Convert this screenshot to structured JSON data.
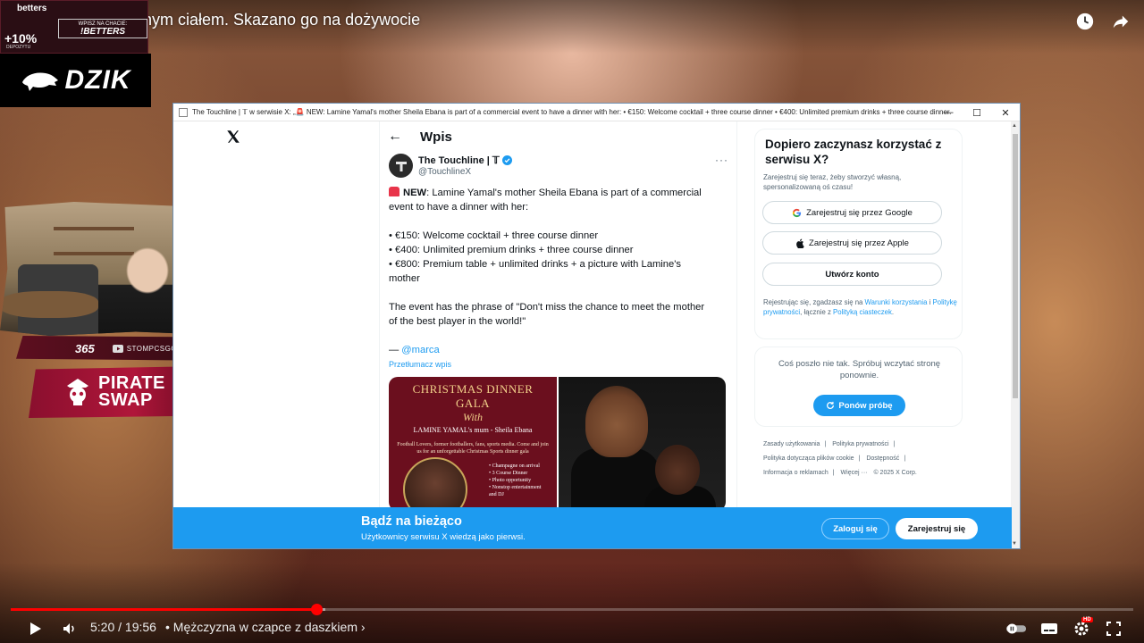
{
  "video": {
    "title": "nym ciałem. Skazano go na dożywocie",
    "current_time": "5:20",
    "duration": "19:56",
    "time_separator": "/",
    "chapter": "Mężczyzna w czapce z daszkiem",
    "progress_fraction": 0.272,
    "buffered_fraction": 0.28
  },
  "overlays": {
    "betters": {
      "logo": "betters",
      "percent": "+10%",
      "percent_sub": "DEPOZYTU",
      "chat_label": "WPISZ NA CHACIE:",
      "chat_code": "!BETTERS"
    },
    "dzik": "DZIK",
    "s365": "365",
    "youtube_handle": "STOMPCSGO",
    "pirate_line1": "PIRATE",
    "pirate_line2": "SWAP"
  },
  "browser": {
    "window_title": "The Touchline | 𝕋 w serwisie X: „🚨 NEW: Lamine Yamal's mother Sheila Ebana is part of a commercial event to have a dinner with her: • €150: Welcome cocktail + three course dinner • €400: Unlimited premium drinks + three course dinner..."
  },
  "x": {
    "header_title": "Wpis",
    "author_name": "The Touchline | 𝕋",
    "author_handle": "@TouchlineX",
    "more": "···",
    "tweet": {
      "new_label": "NEW",
      "line1_rest": ": Lamine Yamal's mother Sheila Ebana is part of a commercial",
      "line2": "event to have a dinner with her:",
      "bullet1": "• €150: Welcome cocktail + three course dinner",
      "bullet2": "• €400: Unlimited premium drinks + three course dinner",
      "bullet3a": "• €800: Premium table + unlimited drinks + a picture with Lamine's",
      "bullet3b": "mother",
      "quote_a": "The event has the phrase of \"Don't miss the chance to meet the mother",
      "quote_b": "of the best player in the world!\"",
      "dash": "— ",
      "source_link": "@marca",
      "translate": "Przetłumacz wpis"
    },
    "poster": {
      "title1": "CHRISTMAS DINNER GALA",
      "title2": "With",
      "subtitle": "LAMINE YAMAL's mum - Sheila Ebana",
      "desc": "Football Lovers, former footballers, fans, sports media. Come and join us for an unforgettable Christmas Sports dinner gala",
      "bullets": [
        "• Champagne on arrival",
        "• 3 Course Dinner",
        "• Photo opportunity",
        "• Nonstop entertainment",
        "  and DJ"
      ]
    },
    "signup": {
      "title": "Dopiero zaczynasz korzystać z serwisu X?",
      "desc": "Zarejestruj się teraz, żeby stworzyć własną, spersonalizowaną oś czasu!",
      "google": "Zarejestruj się przez Google",
      "apple": "Zarejestruj się przez Apple",
      "create": "Utwórz konto",
      "legal_a": "Rejestrując się, zgadzasz się na ",
      "legal_terms": "Warunki korzystania",
      "legal_i": " i ",
      "legal_privacy": "Politykę prywatności",
      "legal_b": ", łącznie z ",
      "legal_cookies": "Polityką ciasteczek",
      "legal_end": "."
    },
    "error": {
      "text": "Coś poszło nie tak. Spróbuj wczytać stronę ponownie.",
      "retry": "Ponów próbę"
    },
    "footer": {
      "l1": "Zasady użytkowania",
      "l2": "Polityka prywatności",
      "l3": "Polityka dotycząca plików cookie",
      "l4": "Dostępność",
      "l5": "Informacja o reklamach",
      "l6": "Więcej ···",
      "copyright": "© 2025 X Corp.",
      "sep": "|"
    },
    "banner": {
      "title": "Bądź na bieżąco",
      "subtitle": "Użytkownicy serwisu X wiedzą jako pierwsi.",
      "login": "Zaloguj się",
      "register": "Zarejestruj się"
    }
  },
  "player": {
    "hd_badge": "HD"
  },
  "colors": {
    "x_blue": "#1d9bf0",
    "yt_red": "#ff0000",
    "poster_red": "#6b0f1e"
  }
}
